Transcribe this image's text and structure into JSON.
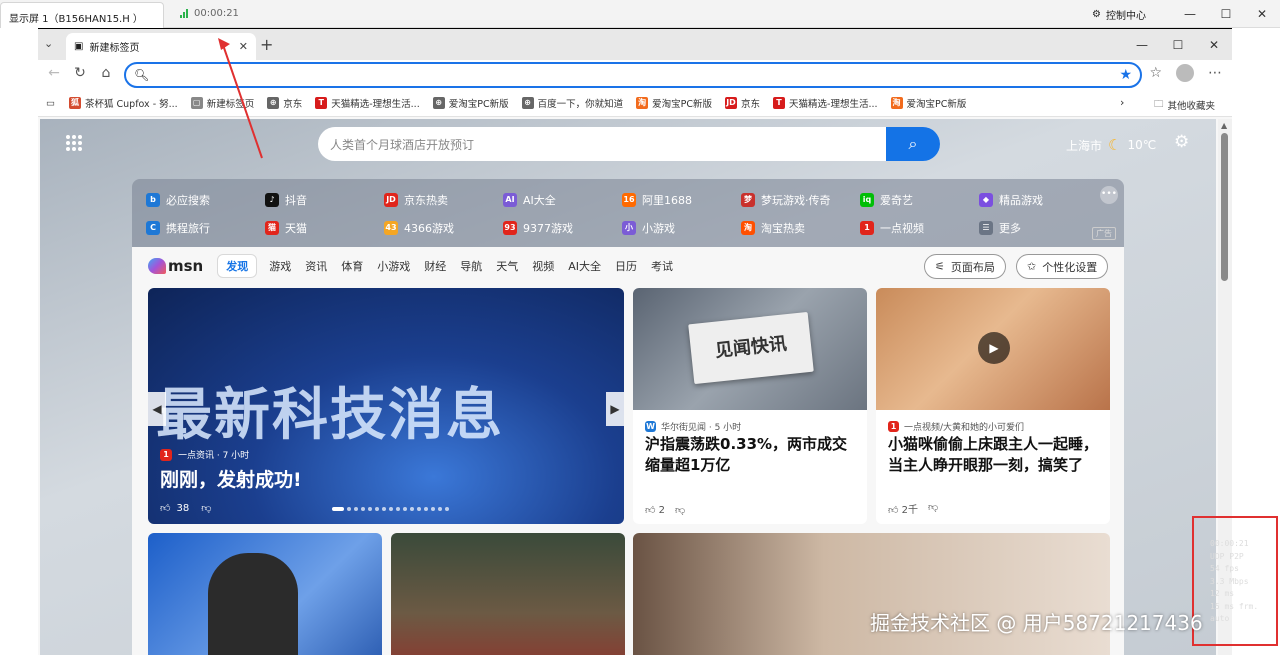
{
  "remote": {
    "tab_label": "显示屏 1（B156HAN15.H ）",
    "timer": "00:00:21",
    "control_center": "控制中心",
    "win_min": "—",
    "win_max": "☐",
    "win_close": "✕",
    "stats": [
      "00:00:21",
      "UDP P2P",
      "54 fps",
      "3.3 Mbps",
      "12 ms",
      "15 ms frm.",
      "auto"
    ]
  },
  "browser": {
    "tab_title": "新建标签页",
    "tab_close": "✕",
    "new_tab": "+",
    "address_value": "",
    "bookmarks": [
      {
        "label": "茶杯狐 Cupfox - 努...",
        "color": "#d44b2f",
        "glyph": "狐"
      },
      {
        "label": "新建标签页",
        "color": "#888888",
        "glyph": "▢"
      },
      {
        "label": "京东",
        "color": "#666666",
        "glyph": "⊕"
      },
      {
        "label": "天猫精选-理想生活...",
        "color": "#d71c1c",
        "glyph": "T"
      },
      {
        "label": "爱淘宝PC新版",
        "color": "#666666",
        "glyph": "⊕"
      },
      {
        "label": "百度一下，你就知道",
        "color": "#666666",
        "glyph": "⊕"
      },
      {
        "label": "爱淘宝PC新版",
        "color": "#f26b1d",
        "glyph": "淘"
      },
      {
        "label": "京东",
        "color": "#d71c1c",
        "glyph": "JD"
      },
      {
        "label": "天猫精选-理想生活...",
        "color": "#d71c1c",
        "glyph": "T"
      },
      {
        "label": "爱淘宝PC新版",
        "color": "#f26b1d",
        "glyph": "淘"
      }
    ],
    "other_bookmarks": "其他收藏夹"
  },
  "newtab": {
    "search_placeholder": "人类首个月球酒店开放预订",
    "city": "上海市",
    "temp": "10℃",
    "quick_links": [
      {
        "label": "必应搜索",
        "color": "#1e78d6",
        "glyph": "b"
      },
      {
        "label": "抖音",
        "color": "#111111",
        "glyph": "♪"
      },
      {
        "label": "京东热卖",
        "color": "#e1251b",
        "glyph": "JD"
      },
      {
        "label": "AI大全",
        "color": "#7b5cd6",
        "glyph": "AI"
      },
      {
        "label": "阿里1688",
        "color": "#ff6a00",
        "glyph": "16"
      },
      {
        "label": "梦玩游戏·传奇",
        "color": "#c9302c",
        "glyph": "梦"
      },
      {
        "label": "爱奇艺",
        "color": "#00be06",
        "glyph": "iq"
      },
      {
        "label": "精品游戏",
        "color": "#7b4fe0",
        "glyph": "◆"
      },
      {
        "label": "携程旅行",
        "color": "#1e78d6",
        "glyph": "C"
      },
      {
        "label": "天猫",
        "color": "#e1251b",
        "glyph": "猫"
      },
      {
        "label": "4366游戏",
        "color": "#f5a623",
        "glyph": "43"
      },
      {
        "label": "9377游戏",
        "color": "#e1251b",
        "glyph": "93"
      },
      {
        "label": "小游戏",
        "color": "#7b5cd6",
        "glyph": "小"
      },
      {
        "label": "淘宝热卖",
        "color": "#ff5000",
        "glyph": "淘"
      },
      {
        "label": "一点视频",
        "color": "#e1251b",
        "glyph": "1"
      },
      {
        "label": "更多",
        "color": "#6b7585",
        "glyph": "☰"
      }
    ],
    "ad_label": "广告",
    "msn": "msn",
    "categories": [
      "发现",
      "游戏",
      "资讯",
      "体育",
      "小游戏",
      "财经",
      "导航",
      "天气",
      "视频",
      "AI大全",
      "日历",
      "考试"
    ],
    "layout_btn": "页面布局",
    "personalize_btn": "个性化设置",
    "hero": {
      "big_text": "最新科技消息",
      "source": "一点资讯 · 7 小时",
      "title": "刚刚，发射成功!",
      "likes": "38"
    },
    "news": [
      {
        "source": "华尔街见闻 · 5 小时",
        "title": "沪指震荡跌0.33%，两市成交缩量超1万亿",
        "likes": "2",
        "img_text": "见闻快讯"
      },
      {
        "source": "一点视频/大黄和她的小可爱们",
        "title": "小猫咪偷偷上床跟主人一起睡，当主人睁开眼那一刻，搞笑了",
        "likes": "2千"
      }
    ]
  },
  "watermark": "掘金技术社区 @ 用户58721217436"
}
